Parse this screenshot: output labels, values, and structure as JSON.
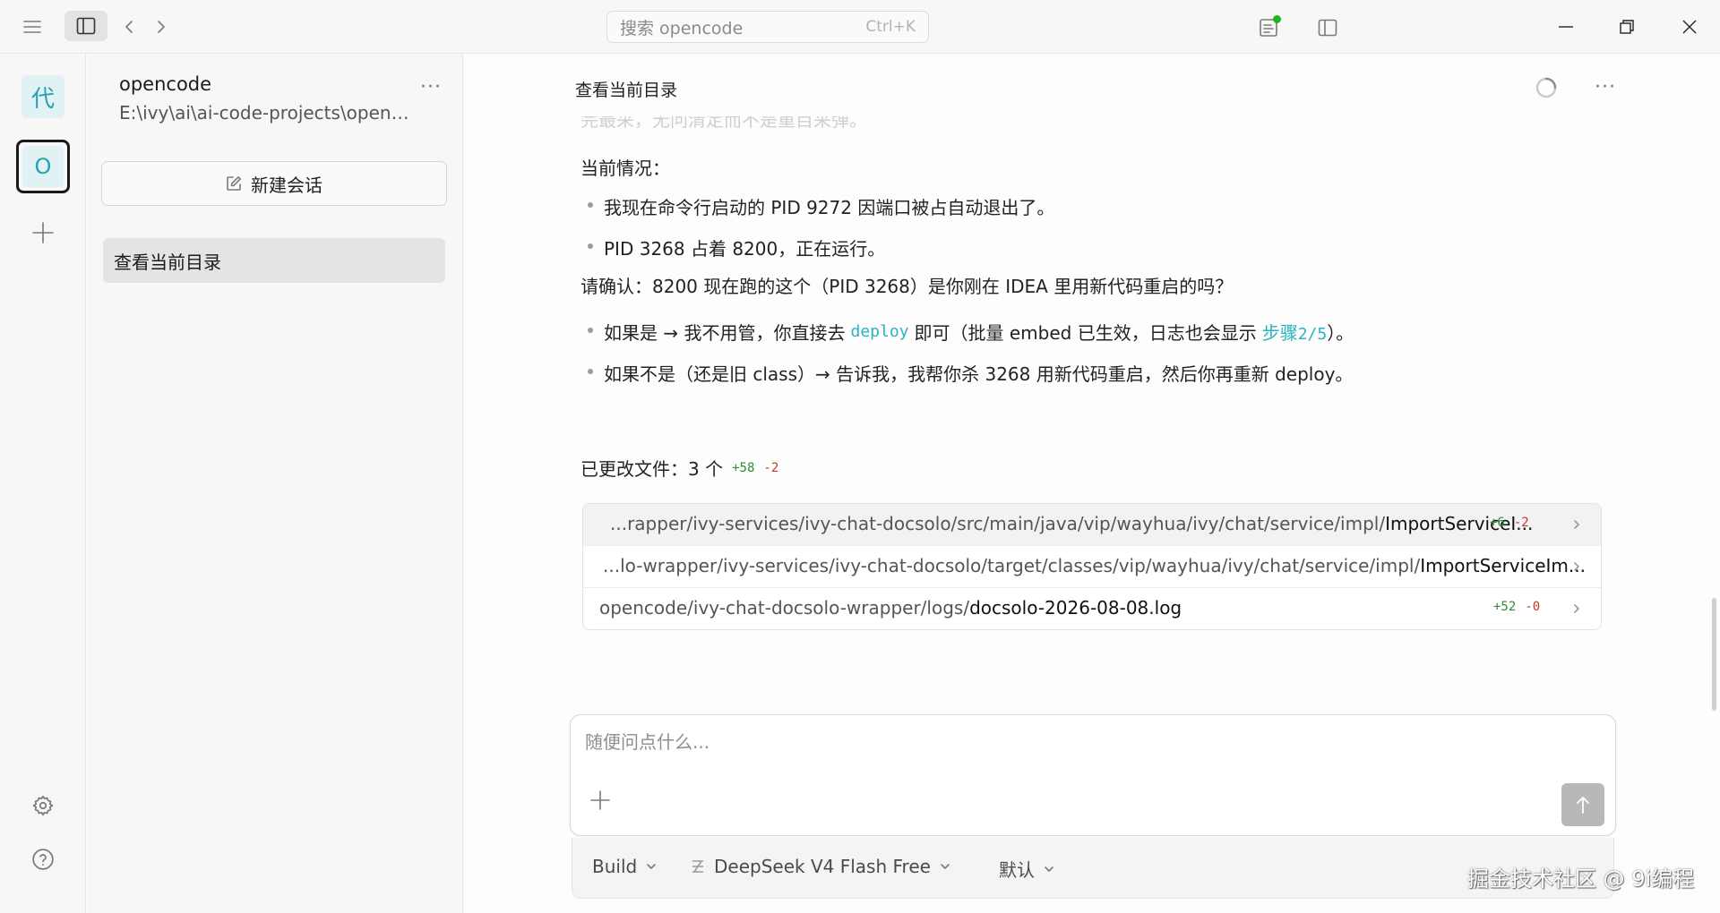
{
  "titlebar": {
    "search_placeholder": "搜索 opencode",
    "search_shortcut": "Ctrl+K"
  },
  "rail": {
    "projects": [
      {
        "label": "代"
      },
      {
        "label": "O"
      }
    ]
  },
  "sidebar": {
    "project_name": "opencode",
    "project_path": "E:\\ivy\\ai\\ai-code-projects\\openc...",
    "more": "···",
    "new_session_label": "新建会话",
    "sessions": [
      {
        "title": "查看当前目录"
      }
    ]
  },
  "chat": {
    "title": "查看当前目录",
    "more": "···",
    "faded_text": "完最采，无问清定而不是重目采弹。",
    "status_heading": "当前情况：",
    "bullets_status": [
      "我现在命令行启动的 PID 9272 因端口被占自动退出了。",
      "PID 3268 占着 8200，正在运行。"
    ],
    "confirm_question": "请确认：8200 现在跑的这个（PID 3268）是你刚在 IDEA 里用新代码重启的吗？",
    "option_yes": {
      "prefix": "如果是 → 我不用管，你直接去",
      "code": "deploy",
      "middle": "即可（批量 embed 已生效，日志也会显示",
      "step_text": "步骤",
      "step_code": "2/5",
      "suffix": "）。"
    },
    "option_no": "如果不是（还是旧 class）→ 告诉我，我帮你杀 3268 用新代码重启，然后你再重新 deploy。",
    "changes": {
      "label": "已更改文件：3 个",
      "added": "+58",
      "removed": "-2"
    },
    "files": [
      {
        "dir": "...rapper/ivy-services/ivy-chat-docsolo/src/main/java/vip/wayhua/ivy/chat/service/impl/",
        "name": "ImportServiceI...",
        "added": "+6",
        "removed": "-2"
      },
      {
        "dir": "...lo-wrapper/ivy-services/ivy-chat-docsolo/target/classes/vip/wayhua/ivy/chat/service/impl/",
        "name": "ImportServiceIm...",
        "added": "",
        "removed": ""
      },
      {
        "dir": "opencode/ivy-chat-docsolo-wrapper/logs/",
        "name": "docsolo-2026-08-08.log",
        "added": "+52",
        "removed": "-0"
      }
    ]
  },
  "composer": {
    "placeholder": "随便问点什么...",
    "agent": "Build",
    "model": "DeepSeek V4 Flash Free",
    "variant": "默认"
  },
  "watermark": "掘金技术社区 @ 9i编程",
  "colors": {
    "accent": "#2bb3c0",
    "added": "#2f8a3a",
    "removed": "#c0392b",
    "status_dot": "#1eb41e"
  }
}
